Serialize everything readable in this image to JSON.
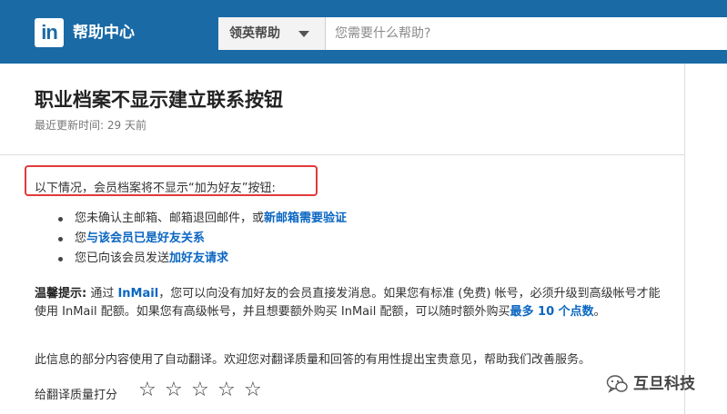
{
  "header": {
    "logo_text": "in",
    "brand": "帮助中心",
    "scope_label": "领英帮助",
    "search_placeholder": "您需要什么帮助?"
  },
  "article": {
    "title": "职业档案不显示建立联系按钮",
    "updated": "最近更新时间: 29 天前",
    "intro": "以下情况，会员档案将不显示“加为好友”按钮:",
    "bullets": [
      {
        "text": "您未确认主邮箱、邮箱退回邮件，或",
        "link": "新邮箱需要验证"
      },
      {
        "text": "您",
        "link": "与该会员已是好友关系"
      },
      {
        "text": "您已向该会员发送",
        "link": "加好友请求"
      }
    ],
    "tip": {
      "label": "温馨提示:",
      "part1": " 通过 ",
      "inmail_link": "InMail",
      "part2": "，您可以向没有加好友的会员直接发消息。如果您有标准 (免费) 帐号，必须升级到高级帐号才能使用 InMail 配额。如果您有高级帐号，并且想要额外购买 InMail 配额，可以随时额外购买",
      "buy_link": "最多 10 个点数",
      "end": "。"
    },
    "notice": "此信息的部分内容使用了自动翻译。欢迎您对翻译质量和回答的有用性提出宝贵意见，帮助我们改善服务。",
    "rating_label": "给翻译质量打分",
    "stars": [
      "☆",
      "☆",
      "☆",
      "☆",
      "☆"
    ]
  },
  "watermark": {
    "text": "互旦科技"
  },
  "colors": {
    "header_bg": "#1a6aa6",
    "link": "#0a66c2",
    "highlight_border": "#e23a3a"
  }
}
